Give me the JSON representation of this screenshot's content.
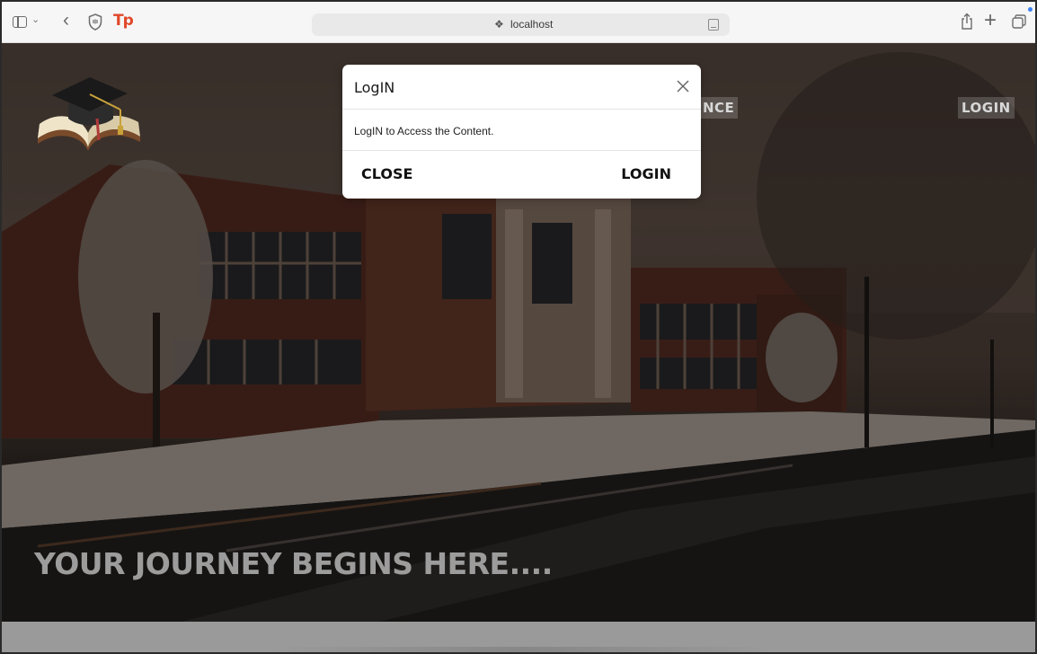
{
  "browser": {
    "url": "localhost"
  },
  "nav": {
    "partial_link": "NCE",
    "login_link": "LOGIN"
  },
  "hero": {
    "title": "YOUR JOURNEY BEGINS HERE...."
  },
  "modal": {
    "title": "LogIN",
    "message": "LogIN to Access the Content.",
    "close_button": "CLOSE",
    "login_button": "LOGIN"
  },
  "colors": {
    "accent_blue": "#3b82f6",
    "tp_logo": "#e0492b"
  }
}
